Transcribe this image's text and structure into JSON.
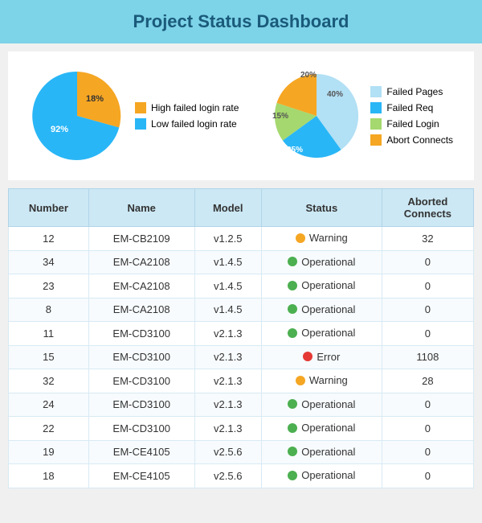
{
  "header": {
    "title": "Project Status Dashboard"
  },
  "chart1": {
    "legend": [
      {
        "label": "High failed login rate",
        "color": "#f5a623"
      },
      {
        "label": "Low failed login rate",
        "color": "#29b6f6"
      }
    ],
    "slices": [
      {
        "pct": 18,
        "color": "#f5a623"
      },
      {
        "pct": 92,
        "color": "#29b6f6"
      }
    ]
  },
  "chart2": {
    "legend": [
      {
        "label": "Failed Pages",
        "color": "#b2e0f5"
      },
      {
        "label": "Failed Req",
        "color": "#29b6f6"
      },
      {
        "label": "Failed Login",
        "color": "#a5d86e"
      },
      {
        "label": "Abort Connects",
        "color": "#f5a623"
      }
    ],
    "slices": [
      {
        "pct": 40,
        "label": "40%",
        "color": "#b2e0f5"
      },
      {
        "pct": 25,
        "label": "25%",
        "color": "#29b6f6"
      },
      {
        "pct": 15,
        "label": "15%",
        "color": "#a5d86e"
      },
      {
        "pct": 20,
        "label": "20%",
        "color": "#f5a623"
      }
    ]
  },
  "table": {
    "columns": [
      "Number",
      "Name",
      "Model",
      "Status",
      "Aborted Connects"
    ],
    "rows": [
      {
        "number": "12",
        "name": "EM-CB2109",
        "model": "v1.2.5",
        "status": "Warning",
        "status_type": "warning",
        "aborted": "32"
      },
      {
        "number": "34",
        "name": "EM-CA2108",
        "model": "v1.4.5",
        "status": "Operational",
        "status_type": "operational",
        "aborted": "0"
      },
      {
        "number": "23",
        "name": "EM-CA2108",
        "model": "v1.4.5",
        "status": "Operational",
        "status_type": "operational",
        "aborted": "0"
      },
      {
        "number": "8",
        "name": "EM-CA2108",
        "model": "v1.4.5",
        "status": "Operational",
        "status_type": "operational",
        "aborted": "0"
      },
      {
        "number": "11",
        "name": "EM-CD3100",
        "model": "v2.1.3",
        "status": "Operational",
        "status_type": "operational",
        "aborted": "0"
      },
      {
        "number": "15",
        "name": "EM-CD3100",
        "model": "v2.1.3",
        "status": "Error",
        "status_type": "error",
        "aborted": "1108"
      },
      {
        "number": "32",
        "name": "EM-CD3100",
        "model": "v2.1.3",
        "status": "Warning",
        "status_type": "warning",
        "aborted": "28"
      },
      {
        "number": "24",
        "name": "EM-CD3100",
        "model": "v2.1.3",
        "status": "Operational",
        "status_type": "operational",
        "aborted": "0"
      },
      {
        "number": "22",
        "name": "EM-CD3100",
        "model": "v2.1.3",
        "status": "Operational",
        "status_type": "operational",
        "aborted": "0"
      },
      {
        "number": "19",
        "name": "EM-CE4105",
        "model": "v2.5.6",
        "status": "Operational",
        "status_type": "operational",
        "aborted": "0"
      },
      {
        "number": "18",
        "name": "EM-CE4105",
        "model": "v2.5.6",
        "status": "Operational",
        "status_type": "operational",
        "aborted": "0"
      }
    ]
  }
}
